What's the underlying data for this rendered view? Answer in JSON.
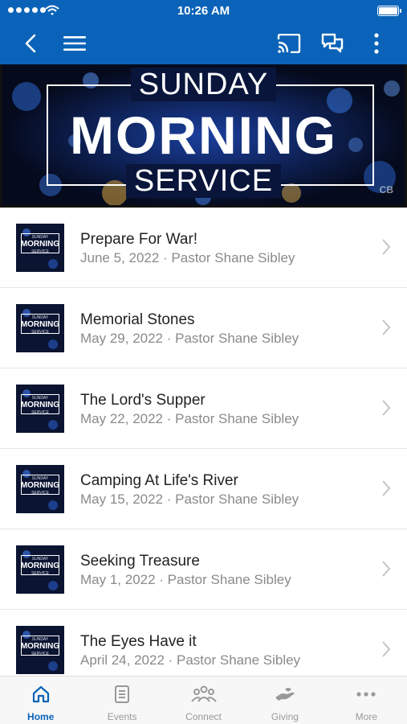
{
  "status_bar": {
    "time": "10:26 AM"
  },
  "nav": {
    "back_icon": "chevron-left-icon",
    "menu_icon": "hamburger-icon",
    "cast_icon": "cast-icon",
    "chat_icon": "chat-icon",
    "more_icon": "more-vertical-icon"
  },
  "banner": {
    "line1": "SUNDAY",
    "line2": "MORNING",
    "line3": "SERVICE",
    "logo": "CB"
  },
  "thumb_text": {
    "sunday": "SUNDAY",
    "morning": "MORNING",
    "service": "SERVICE"
  },
  "sermons": [
    {
      "title": "Prepare For War!",
      "subtitle": "June 5, 2022 · Pastor Shane Sibley"
    },
    {
      "title": "Memorial Stones",
      "subtitle": "May 29, 2022 · Pastor Shane Sibley"
    },
    {
      "title": "The Lord's Supper",
      "subtitle": "May 22, 2022 · Pastor Shane Sibley"
    },
    {
      "title": "Camping At Life's River",
      "subtitle": "May 15, 2022 · Pastor Shane Sibley"
    },
    {
      "title": "Seeking Treasure",
      "subtitle": "May 1, 2022 · Pastor Shane Sibley"
    },
    {
      "title": "The Eyes Have it",
      "subtitle": "April 24, 2022 · Pastor Shane Sibley"
    }
  ],
  "tabs": [
    {
      "label": "Home",
      "icon": "home-icon",
      "active": true
    },
    {
      "label": "Events",
      "icon": "calendar-icon",
      "active": false
    },
    {
      "label": "Connect",
      "icon": "people-icon",
      "active": false
    },
    {
      "label": "Giving",
      "icon": "giving-hand-icon",
      "active": false
    },
    {
      "label": "More",
      "icon": "more-horizontal-icon",
      "active": false
    }
  ],
  "colors": {
    "accent": "#0a63b8",
    "inactive": "#999999"
  }
}
